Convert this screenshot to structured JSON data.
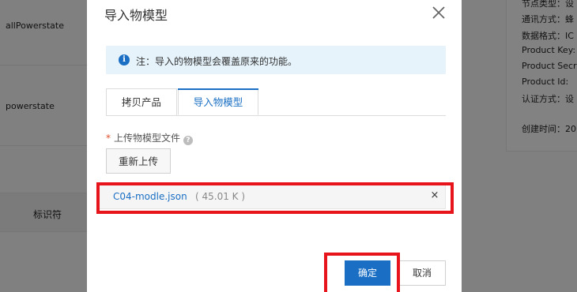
{
  "background": {
    "rows": [
      "allPowerstate",
      "powerstate"
    ],
    "table_header": "标识符",
    "details": [
      "节点类型：设",
      "通讯方式：蜂",
      "数据格式：IC",
      "Product Key:",
      "Product Secre",
      "Product Id:",
      "认证方式：设",
      "创建时间：20"
    ]
  },
  "modal": {
    "title": "导入物模型",
    "alert": {
      "icon": "info-icon",
      "text": "注：导入的物模型会覆盖原来的功能。"
    },
    "tabs": [
      {
        "label": "拷贝产品",
        "active": false
      },
      {
        "label": "导入物模型",
        "active": true
      }
    ],
    "upload_field": {
      "label": "上传物模型文件",
      "required": true,
      "help_icon": "question-circle-icon"
    },
    "reupload_label": "重新上传",
    "file": {
      "name": "C04-modle.json",
      "size": "( 45.01 K )",
      "remove_icon": "close-icon"
    },
    "buttons": {
      "confirm": "确定",
      "cancel": "取消"
    }
  },
  "colors": {
    "primary": "#1a6fc4",
    "highlight": "#e8141b",
    "alert_bg": "#e6f3fb",
    "overlay": "#808080"
  }
}
